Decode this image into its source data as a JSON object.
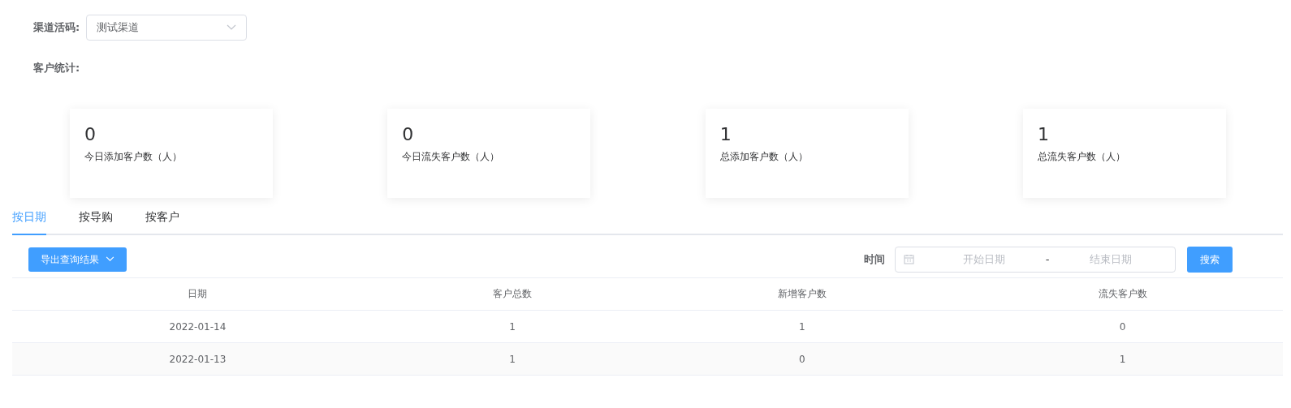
{
  "channel_filter": {
    "label": "渠道活码:",
    "value": "测试渠道"
  },
  "stats": {
    "label": "客户统计:",
    "cards": [
      {
        "value": "0",
        "caption": "今日添加客户数（人）"
      },
      {
        "value": "0",
        "caption": "今日流失客户数（人）"
      },
      {
        "value": "1",
        "caption": "总添加客户数（人）"
      },
      {
        "value": "1",
        "caption": "总流失客户数（人）"
      }
    ]
  },
  "tabs": [
    {
      "label": "按日期",
      "selected": true
    },
    {
      "label": "按导购",
      "selected": false
    },
    {
      "label": "按客户",
      "selected": false
    }
  ],
  "toolbar": {
    "export_button": "导出查询结果",
    "time_label": "时间",
    "start_placeholder": "开始日期",
    "separator": "-",
    "end_placeholder": "结束日期",
    "search_button": "搜索"
  },
  "table": {
    "columns": [
      "日期",
      "客户总数",
      "新增客户数",
      "流失客户数"
    ],
    "rows": [
      [
        "2022-01-14",
        "1",
        "1",
        "0"
      ],
      [
        "2022-01-13",
        "1",
        "0",
        "1"
      ]
    ]
  }
}
